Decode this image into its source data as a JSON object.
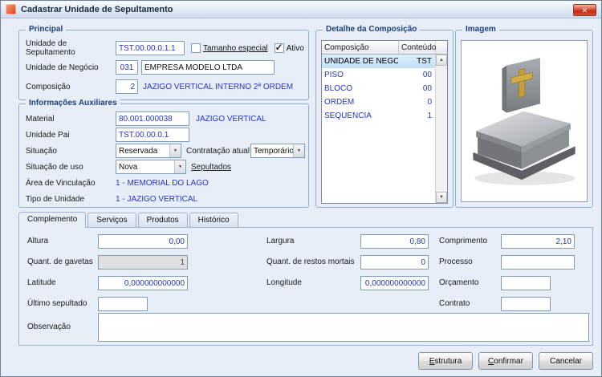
{
  "window": {
    "title": "Cadastrar Unidade de Sepultamento"
  },
  "icons": {
    "close": "✕",
    "combo_arrow": "▼",
    "scroll_up": "▲",
    "scroll_down": "▼"
  },
  "colors": {
    "value_text": "#2335c8",
    "group_title": "#1e3f7d",
    "row_selection": "#c3e0f7",
    "close_button_red": "#c02a12"
  },
  "principal": {
    "title": "Principal",
    "unidade_sepultamento": {
      "label": "Unidade de Sepultamento",
      "value": "TST.00.00.0.1.1"
    },
    "tamanho_especial": {
      "label": "Tamanho especial",
      "checked": false
    },
    "ativo": {
      "label": "Ativo",
      "checked": true
    },
    "unidade_negocio": {
      "label": "Unidade de Negócio",
      "code": "031",
      "name": "EMPRESA MODELO LTDA"
    },
    "composicao": {
      "label": "Composição",
      "code": "2",
      "name": "JAZIGO VERTICAL INTERNO 2ª ORDEM"
    }
  },
  "auxiliares": {
    "title": "Informações Auxiliares",
    "material": {
      "label": "Material",
      "value": "80.001.000038",
      "name": "JAZIGO VERTICAL"
    },
    "unidade_pai": {
      "label": "Unidade Pai",
      "value": "TST.00.00.0.1"
    },
    "situacao": {
      "label": "Situação",
      "value": "Reservada"
    },
    "contratacao_atual": {
      "label": "Contratação atual",
      "value": "Temporário"
    },
    "situacao_uso": {
      "label": "Situação de uso",
      "value": "Nova"
    },
    "sepultados_link": "Sepultados",
    "area_vinculacao": {
      "label": "Área de Vinculação",
      "value": "1 - MEMORIAL DO LAGO"
    },
    "tipo_unidade": {
      "label": "Tipo de Unidade",
      "value": "1 - JAZIGO VERTICAL"
    }
  },
  "detalhe": {
    "title": "Detalhe da Composição",
    "columns": [
      "Composição",
      "Conteúdo"
    ],
    "rows": [
      {
        "name": "UNIDADE DE NEGOCIO",
        "value": "TST",
        "selected": true
      },
      {
        "name": "PISO",
        "value": "00",
        "selected": false
      },
      {
        "name": "BLOCO",
        "value": "00",
        "selected": false
      },
      {
        "name": "ORDEM",
        "value": "0",
        "selected": false
      },
      {
        "name": "SEQUENCIA",
        "value": "1",
        "selected": false
      }
    ]
  },
  "imagem": {
    "title": "Imagem"
  },
  "tabs": [
    {
      "label": "Complemento",
      "active": true
    },
    {
      "label": "Serviços",
      "active": false
    },
    {
      "label": "Produtos",
      "active": false
    },
    {
      "label": "Histórico",
      "active": false
    }
  ],
  "complemento": {
    "altura": {
      "label": "Altura",
      "value": "0,00"
    },
    "largura": {
      "label": "Largura",
      "value": "0,80"
    },
    "comprimento": {
      "label": "Comprimento",
      "value": "2,10"
    },
    "quant_gavetas": {
      "label": "Quant. de gavetas",
      "value": "1",
      "disabled": true
    },
    "quant_restos_mortais": {
      "label": "Quant. de restos mortais",
      "value": "0"
    },
    "processo": {
      "label": "Processo",
      "value": ""
    },
    "latitude": {
      "label": "Latitude",
      "value": "0,000000000000"
    },
    "longitude": {
      "label": "Longitude",
      "value": "0,000000000000"
    },
    "orcamento": {
      "label": "Orçamento",
      "value": ""
    },
    "ultimo_sepultado": {
      "label": "Último sepultado",
      "value": ""
    },
    "contrato": {
      "label": "Contrato",
      "value": ""
    },
    "observacao": {
      "label": "Observação",
      "value": ""
    }
  },
  "footer": {
    "estrutura": "Estrutura",
    "confirmar": "Confirmar",
    "cancelar": "Cancelar"
  }
}
